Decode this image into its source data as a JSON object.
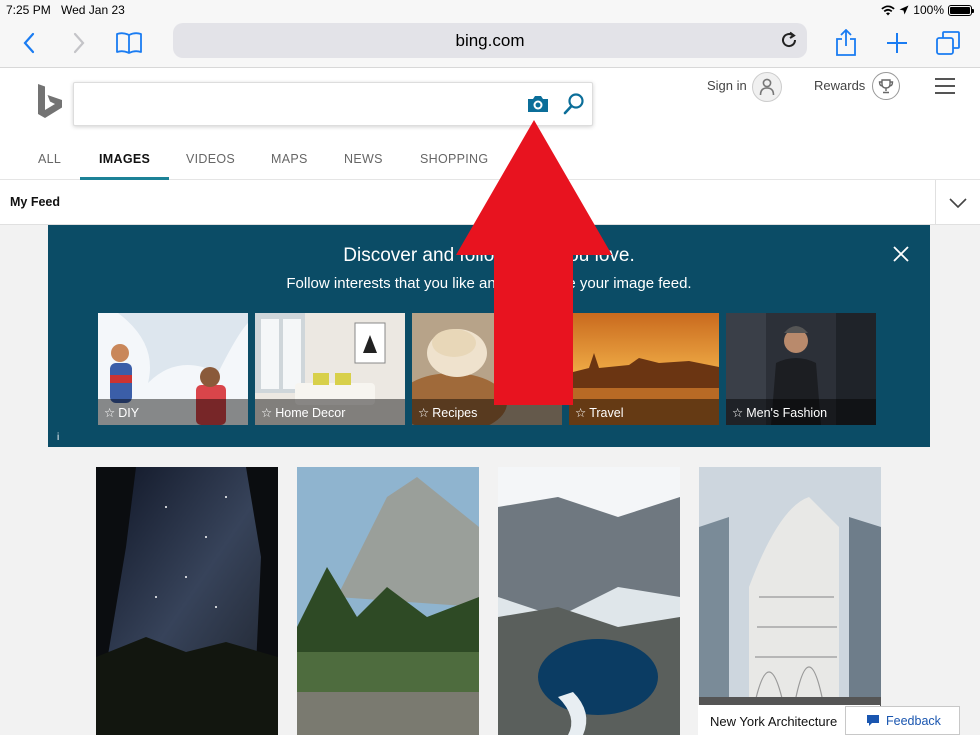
{
  "status_bar": {
    "time": "7:25 PM",
    "date": "Wed Jan 23",
    "battery": "100%"
  },
  "browser": {
    "url": "bing.com"
  },
  "header": {
    "search_placeholder": "",
    "sign_in_label": "Sign in",
    "rewards_label": "Rewards"
  },
  "nav_tabs": [
    "ALL",
    "IMAGES",
    "VIDEOS",
    "MAPS",
    "NEWS",
    "SHOPPING"
  ],
  "active_tab": "IMAGES",
  "feed": {
    "label": "My Feed"
  },
  "banner": {
    "title": "Discover and follow what you love.",
    "subtitle": "Follow interests that you like and customize your image feed.",
    "info": "i",
    "tiles": [
      "DIY",
      "Home Decor",
      "Recipes",
      "Travel",
      "Men's Fashion"
    ]
  },
  "grid": {
    "caption": "New York Architecture"
  },
  "feedback_label": "Feedback",
  "colors": {
    "accent": "#1c8297",
    "banner": "#0b4c66",
    "ios_blue": "#1a7cf2",
    "arrow": "#e8131f"
  }
}
